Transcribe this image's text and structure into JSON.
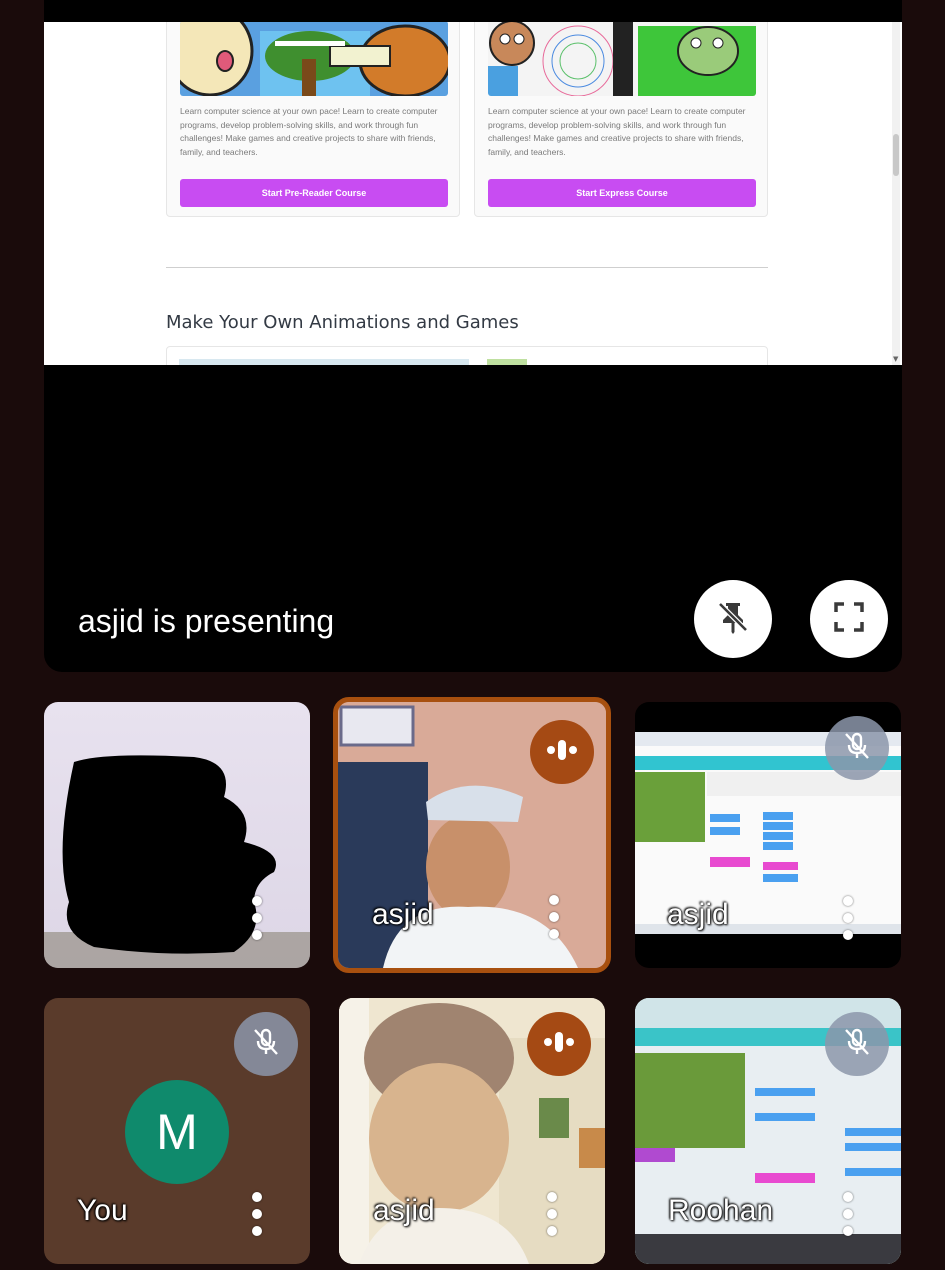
{
  "shared_screen": {
    "cards": [
      {
        "description": "Learn computer science at your own pace! Learn to create computer programs, develop problem-solving skills, and work through fun challenges! Make games and creative projects to share with friends, family, and teachers.",
        "button": "Start Pre-Reader Course"
      },
      {
        "description": "Learn computer science at your own pace! Learn to create computer programs, develop problem-solving skills, and work through fun challenges! Make games and creative projects to share with friends, family, and teachers.",
        "button": "Start Express Course"
      }
    ],
    "section_title": "Make Your Own Animations and Games"
  },
  "presenter_label": "asjid is presenting",
  "tiles": [
    {
      "name": "",
      "state": "hidden"
    },
    {
      "name": "asjid",
      "state": "speaking"
    },
    {
      "name": "asjid",
      "state": "muted"
    },
    {
      "name": "You",
      "avatar_letter": "M",
      "avatar_color": "#0f8a6c",
      "state": "muted"
    },
    {
      "name": "asjid",
      "state": "speaking"
    },
    {
      "name": "Roohan",
      "state": "muted"
    }
  ],
  "colors": {
    "accent_purple": "#c84cf2",
    "speaking_badge": "#a54a14",
    "page_bg": "#1a0b0b"
  }
}
